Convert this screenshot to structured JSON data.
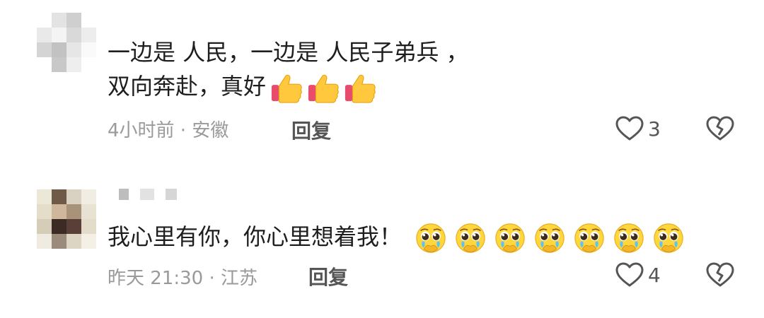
{
  "comments": [
    {
      "text_line1": "一边是  人民，一边是  人民子弟兵  ，",
      "text_line2": "双向奔赴，真好",
      "emojis": [
        "thumbs-up",
        "thumbs-up",
        "thumbs-up"
      ],
      "meta": "4小时前 · 安徽",
      "reply_label": "回复",
      "like_count": "3"
    },
    {
      "text": "我心里有你，你心里想着我！",
      "emojis": [
        "pleading-face",
        "pleading-face",
        "pleading-face",
        "pleading-face",
        "pleading-face",
        "pleading-face",
        "pleading-face"
      ],
      "meta": "昨天 21:30 · 江苏",
      "reply_label": "回复",
      "like_count": "4"
    }
  ],
  "colors": {
    "text": "#1e1e1e",
    "meta": "#9a9a9a",
    "action": "#555555"
  }
}
